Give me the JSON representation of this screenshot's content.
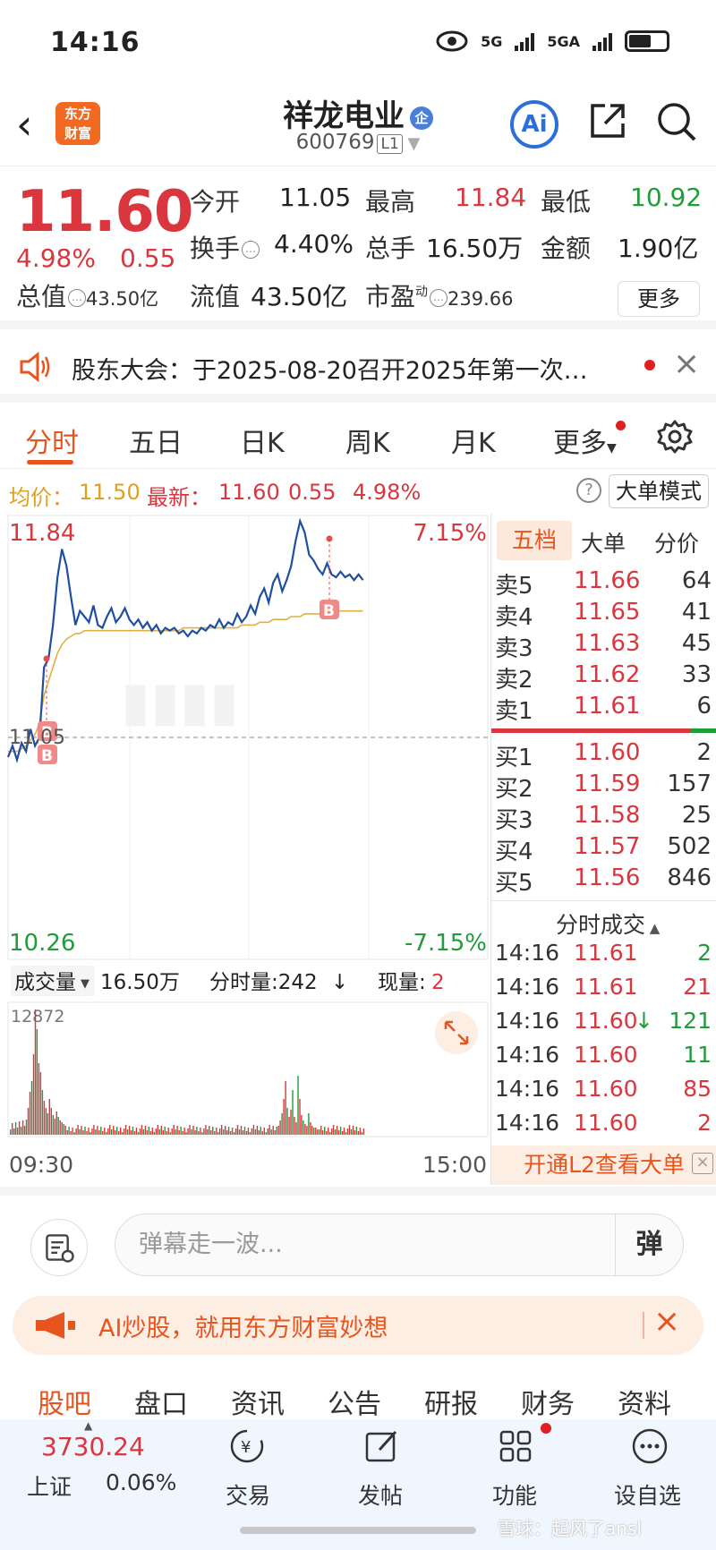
{
  "status": {
    "time": "14:16",
    "net1": "5G",
    "net2": "5GA"
  },
  "header": {
    "logo_line1": "东方",
    "logo_line2": "财富",
    "name": "祥龙电业",
    "badge": "企",
    "code": "600769",
    "level": "L1",
    "ai": "Ai"
  },
  "quote": {
    "price": "11.60",
    "pct": "4.98%",
    "change": "0.55",
    "open_label": "今开",
    "open": "11.05",
    "high_label": "最高",
    "high": "11.84",
    "low_label": "最低",
    "low": "10.92",
    "turnover_label": "换手",
    "turnover": "4.40%",
    "volume_label": "总手",
    "volume": "16.50万",
    "amount_label": "金额",
    "amount": "1.90亿",
    "mktcap_label": "总值",
    "mktcap": "43.50亿",
    "float_label": "流值",
    "float": "43.50亿",
    "pe_label": "市盈",
    "pe_sup": "动",
    "pe": "239.66",
    "more": "更多"
  },
  "notice": {
    "text": "股东大会：于2025-08-20召开2025年第一次…"
  },
  "tabs": [
    "分时",
    "五日",
    "日K",
    "周K",
    "月K",
    "更多"
  ],
  "infoline": {
    "avg_label": "均价：",
    "avg": "11.50",
    "last_label": "最新：",
    "last": "11.60",
    "chg": "0.55",
    "pct": "4.98%",
    "help": "?",
    "mode": "大单模式"
  },
  "chart": {
    "top_price": "11.84",
    "top_pct": "7.15%",
    "bottom_price": "10.26",
    "bottom_pct": "-7.15%",
    "mid_price": "11.05",
    "vol_label": "成交量",
    "vol_total": "16.50万",
    "tick_label": "分时量:242",
    "tick_arrow": "↓",
    "now_label": "现量:",
    "now_val": "2",
    "vol_max": "12872",
    "time_start": "09:30",
    "time_end": "15:00",
    "marker": "B"
  },
  "chart_data": {
    "type": "line",
    "ylim": [
      10.26,
      11.84
    ],
    "pct_range": [
      "-7.15%",
      "7.15%"
    ],
    "prev_close": 11.05,
    "x": [
      "09:30",
      "15:00"
    ],
    "series": [
      {
        "values": [
          10.98,
          11.02,
          10.97,
          11.03,
          11.0,
          11.08,
          11.02,
          11.05,
          11.3,
          11.33,
          11.45,
          11.62,
          11.72,
          11.66,
          11.55,
          11.45,
          11.5,
          11.48,
          11.46,
          11.52,
          11.45,
          11.44,
          11.48,
          11.51,
          11.46,
          11.48,
          11.51,
          11.47,
          11.45,
          11.47,
          11.44,
          11.46,
          11.43,
          11.45,
          11.42,
          11.44,
          11.43,
          11.44,
          11.42,
          11.43,
          11.41,
          11.43,
          11.42,
          11.44,
          11.43,
          11.45,
          11.44,
          11.47,
          11.44,
          11.46,
          11.45,
          11.49,
          11.46,
          11.48,
          11.52,
          11.49,
          11.55,
          11.58,
          11.53,
          11.6,
          11.63,
          11.57,
          11.61,
          11.66,
          11.75,
          11.82,
          11.78,
          11.7,
          11.68,
          11.65,
          11.63,
          11.67,
          11.63,
          11.62,
          11.64,
          11.62,
          11.63,
          11.61,
          11.63,
          11.61
        ]
      },
      {
        "values": [
          11.0,
          11.0,
          11.0,
          11.01,
          11.02,
          11.04,
          11.06,
          11.1,
          11.2,
          11.25,
          11.3,
          11.35,
          11.38,
          11.4,
          11.41,
          11.42,
          11.42,
          11.43,
          11.43,
          11.43,
          11.43,
          11.43,
          11.43,
          11.43,
          11.43,
          11.43,
          11.43,
          11.43,
          11.43,
          11.43,
          11.43,
          11.43,
          11.43,
          11.43,
          11.43,
          11.43,
          11.43,
          11.43,
          11.43,
          11.44,
          11.44,
          11.44,
          11.44,
          11.44,
          11.44,
          11.44,
          11.44,
          11.44,
          11.44,
          11.44,
          11.44,
          11.44,
          11.45,
          11.45,
          11.45,
          11.45,
          11.46,
          11.46,
          11.46,
          11.47,
          11.47,
          11.47,
          11.47,
          11.48,
          11.48,
          11.48,
          11.49,
          11.49,
          11.49,
          11.49,
          11.49,
          11.49,
          11.5,
          11.5,
          11.5,
          11.5,
          11.5,
          11.5,
          11.5,
          11.5
        ]
      }
    ],
    "volume_ymax": 12872
  },
  "book": {
    "tabs": [
      "五档",
      "大单",
      "分价"
    ],
    "asks": [
      {
        "label": "卖5",
        "price": "11.66",
        "qty": "64"
      },
      {
        "label": "卖4",
        "price": "11.65",
        "qty": "41"
      },
      {
        "label": "卖3",
        "price": "11.63",
        "qty": "45"
      },
      {
        "label": "卖2",
        "price": "11.62",
        "qty": "33"
      },
      {
        "label": "卖1",
        "price": "11.61",
        "qty": "6"
      }
    ],
    "bids": [
      {
        "label": "买1",
        "price": "11.60",
        "qty": "2"
      },
      {
        "label": "买2",
        "price": "11.59",
        "qty": "157"
      },
      {
        "label": "买3",
        "price": "11.58",
        "qty": "25"
      },
      {
        "label": "买4",
        "price": "11.57",
        "qty": "502"
      },
      {
        "label": "买5",
        "price": "11.56",
        "qty": "846"
      }
    ],
    "trades_title": "分时成交",
    "trades": [
      {
        "time": "14:16",
        "price": "11.61",
        "qty": "2",
        "arrow": ""
      },
      {
        "time": "14:16",
        "price": "11.61",
        "qty": "21",
        "arrow": ""
      },
      {
        "time": "14:16",
        "price": "11.60",
        "qty": "121",
        "arrow": "↓"
      },
      {
        "time": "14:16",
        "price": "11.60",
        "qty": "11",
        "arrow": ""
      },
      {
        "time": "14:16",
        "price": "11.60",
        "qty": "85",
        "arrow": ""
      },
      {
        "time": "14:16",
        "price": "11.60",
        "qty": "2",
        "arrow": ""
      }
    ],
    "l2": "开通L2查看大单"
  },
  "comment": {
    "placeholder": "弹幕走一波...",
    "danmu": "弹"
  },
  "ad": {
    "text": "AI炒股，就用东方财富妙想"
  },
  "bottom_tabs": [
    "股吧",
    "盘口",
    "资讯",
    "公告",
    "研报",
    "财务",
    "资料"
  ],
  "footer": {
    "index_value": "3730.24",
    "index_name": "上证",
    "index_pct": "0.06%",
    "trade": "交易",
    "post": "发帖",
    "func": "功能",
    "custom": "设自选",
    "watermark": "雪球：起风了ansl"
  }
}
